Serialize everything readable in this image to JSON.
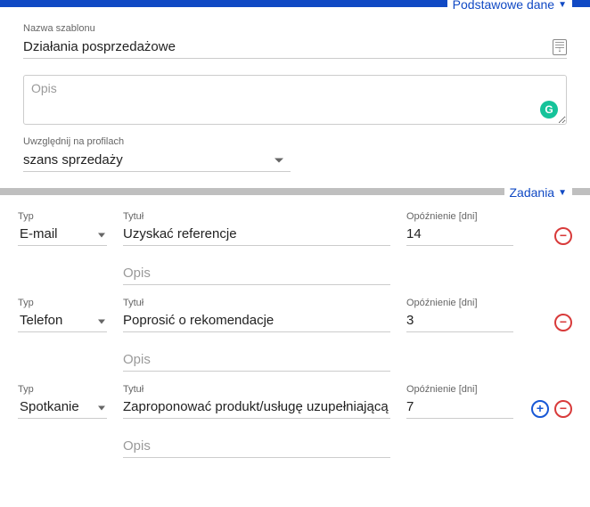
{
  "section1": {
    "title": "Podstawowe dane",
    "name_label": "Nazwa szablonu",
    "name_value": "Działania posprzedażowe",
    "opis_placeholder": "Opis",
    "profiles_label": "Uwzględnij na profilach",
    "profiles_value": "szans sprzedaży"
  },
  "section2": {
    "title": "Zadania",
    "type_label": "Typ",
    "title_label": "Tytuł",
    "delay_label": "Opóźnienie [dni]",
    "opis_placeholder": "Opis",
    "tasks": [
      {
        "type": "E-mail",
        "title": "Uzyskać referencje",
        "delay": "14"
      },
      {
        "type": "Telefon",
        "title": "Poprosić o rekomendacje",
        "delay": "3"
      },
      {
        "type": "Spotkanie",
        "title": "Zaproponować produkt/usługę uzupełniającą",
        "delay": "7"
      }
    ]
  },
  "icons": {
    "grammarly": "G"
  }
}
